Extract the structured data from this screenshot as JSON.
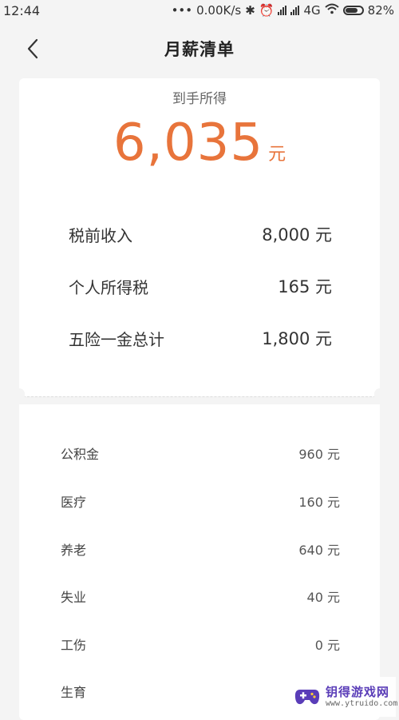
{
  "status_bar": {
    "time": "12:44",
    "network_speed": "0.00K/s",
    "network_type": "4G",
    "battery": "82%"
  },
  "header": {
    "title": "月薪清单",
    "back_icon": "chevron-left-icon"
  },
  "summary": {
    "take_home_label": "到手所得",
    "take_home_amount": "6,035",
    "take_home_unit": "元",
    "rows": [
      {
        "label": "税前收入",
        "value": "8,000 元"
      },
      {
        "label": "个人所得税",
        "value": "165 元"
      },
      {
        "label": "五险一金总计",
        "value": "1,800 元"
      }
    ]
  },
  "details": {
    "rows": [
      {
        "label": "公积金",
        "value": "960 元"
      },
      {
        "label": "医疗",
        "value": "160 元"
      },
      {
        "label": "养老",
        "value": "640 元"
      },
      {
        "label": "失业",
        "value": "40 元"
      },
      {
        "label": "工伤",
        "value": "0 元"
      },
      {
        "label": "生育",
        "value": ""
      }
    ]
  },
  "watermark": {
    "title": "钥得游戏网",
    "url": "www.ytruido.com"
  },
  "colors": {
    "accent": "#e8743b",
    "background": "#f4f4f4",
    "card": "#ffffff"
  }
}
